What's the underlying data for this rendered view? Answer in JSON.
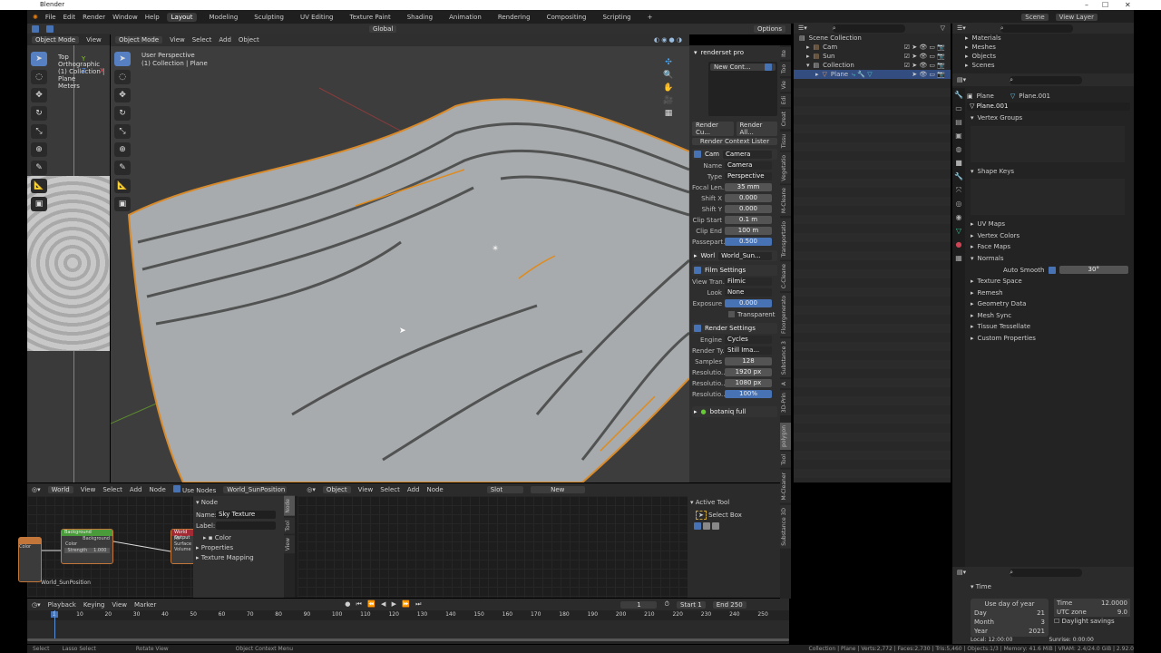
{
  "window": {
    "title": "Blender",
    "controls": [
      "–",
      "☐",
      "✕"
    ]
  },
  "menu": {
    "items": [
      "File",
      "Edit",
      "Render",
      "Window",
      "Help"
    ],
    "workspaces": [
      "Layout",
      "Modeling",
      "Sculpting",
      "UV Editing",
      "Texture Paint",
      "Shading",
      "Animation",
      "Rendering",
      "Compositing",
      "Scripting",
      "+"
    ],
    "active_workspace": "Layout",
    "scene": "Scene",
    "view_layer": "View Layer"
  },
  "viewport_header": {
    "mode": "Object Mode",
    "items": [
      "View",
      "Select",
      "Add",
      "Object"
    ],
    "orientation": "Global",
    "options": "Options"
  },
  "left_viewport": {
    "mode": "Object Mode",
    "view": "View",
    "overlay_title": "Top Orthographic",
    "overlay_collection": "(1) Collection | Plane",
    "overlay_units": "Meters",
    "gizmo": {
      "y": "Y",
      "z": "Z",
      "x": "X"
    }
  },
  "main_viewport": {
    "overlay_title": "User Perspective",
    "overlay_collection": "(1) Collection | Plane"
  },
  "npanel": {
    "renderset": {
      "title": "renderset pro",
      "context": "New Cont...",
      "render_current": "Render Cu...",
      "render_all": "Render All...",
      "lister": "Render Context Lister"
    },
    "camera": {
      "label": "Cam",
      "value": "Camera",
      "fields": [
        {
          "label": "Name",
          "value": "Camera"
        },
        {
          "label": "Type",
          "value": "Perspective"
        },
        {
          "label": "Focal Len...",
          "value": "35 mm"
        },
        {
          "label": "Shift X",
          "value": "0.000"
        },
        {
          "label": "Shift Y",
          "value": "0.000"
        },
        {
          "label": "Clip Start",
          "value": "0.1 m"
        },
        {
          "label": "Clip End",
          "value": "100 m"
        },
        {
          "label": "Passepart...",
          "value": "0.500",
          "fraction": 0.5
        }
      ]
    },
    "world": {
      "label": "Worl",
      "value": "World_Sun..."
    },
    "film": {
      "title": "Film Settings",
      "view_transform_label": "View Tran...",
      "view_transform": "Filmic",
      "look_label": "Look",
      "look": "None",
      "exposure_label": "Exposure",
      "exposure": "0.000",
      "transparent": "Transparent"
    },
    "render": {
      "title": "Render Settings",
      "engine_label": "Engine",
      "engine": "Cycles",
      "render_type_label": "Render Ty...",
      "render_type": "Still Ima...",
      "samples_label": "Samples",
      "samples": "128",
      "res_label": "Resolutio...",
      "res_x": "1920 px",
      "res_y": "1080 px",
      "res_pct": "100%"
    },
    "botaniq": "botaniq full"
  },
  "vtabs": [
    "Ite",
    "Too",
    "Vie",
    "Edi",
    "Creat",
    "Tissu",
    "Vegetatio",
    "M-Cleane",
    "Transportatio",
    "C-Cleane",
    "Floorgenerato",
    "Substance 3",
    "A",
    "3D-Prin",
    "polygon",
    "Tool",
    "M-Cleaner",
    "Substance 3D"
  ],
  "outliner": {
    "rows": [
      {
        "name": "Scene Collection"
      },
      {
        "name": "Cam"
      },
      {
        "name": "Sun"
      },
      {
        "name": "Collection"
      },
      {
        "name": "Plane",
        "selected": true
      }
    ]
  },
  "blend_outliner": {
    "rows": [
      "Materials",
      "Meshes",
      "Objects",
      "Scenes"
    ]
  },
  "properties": {
    "object": "Plane",
    "mesh": "Plane.001",
    "mesh_field": "Plane.001",
    "vertex_groups": "Vertex Groups",
    "shape_keys": "Shape Keys",
    "sections": [
      "UV Maps",
      "Vertex Colors",
      "Face Maps",
      "Normals"
    ],
    "auto_smooth_label": "Auto Smooth",
    "auto_smooth_angle": "30°",
    "sections2": [
      "Texture Space",
      "Remesh",
      "Geometry Data",
      "Mesh Sync",
      "Tissue Tessellate",
      "Custom Properties"
    ]
  },
  "sun_panel": {
    "title": "Time",
    "use_day": "Use day of year",
    "day_label": "Day",
    "day": "21",
    "month_label": "Month",
    "month": "3",
    "year_label": "Year",
    "year": "2021",
    "time_label": "Time",
    "time": "12.0000",
    "utc_label": "UTC zone",
    "utc": "9.0",
    "daylight": "Daylight savings",
    "local": "Local: 12:00:00",
    "sunrise": "Sunrise: 0:00:00"
  },
  "node_editor": {
    "type": "World",
    "items": [
      "View",
      "Select",
      "Add",
      "Node"
    ],
    "use_nodes": "Use Nodes",
    "world_name": "World_SunPosition",
    "panel": {
      "title": "Node",
      "name_label": "Name:",
      "name": "Sky Texture",
      "label_label": "Label:",
      "color": "Color",
      "properties": "Properties",
      "texture_mapping": "Texture Mapping"
    },
    "tabs": [
      "Node",
      "Tool",
      "View"
    ],
    "background_node": {
      "title": "Background",
      "out": "Background",
      "in": "Color",
      "strength_label": "Strength",
      "strength": "1.000"
    },
    "output_node": {
      "title": "World Output",
      "target": "All",
      "surface": "Surface",
      "volume": "Volume"
    },
    "frame_label": "World_SunPosition",
    "color_socket": "Color"
  },
  "shader_editor": {
    "type": "Object",
    "items": [
      "View",
      "Select",
      "Add",
      "Node"
    ],
    "slot": "Slot",
    "new": "New",
    "active_tool": "Active Tool",
    "select_box": "Select Box"
  },
  "timeline": {
    "items": [
      "Playback",
      "Keying",
      "View",
      "Marker"
    ],
    "current": "1",
    "start_label": "Start",
    "start": "1",
    "end_label": "End",
    "end": "250",
    "ticks": [
      "1",
      "10",
      "20",
      "30",
      "40",
      "50",
      "60",
      "70",
      "80",
      "90",
      "100",
      "110",
      "120",
      "130",
      "140",
      "150",
      "160",
      "170",
      "180",
      "190",
      "200",
      "210",
      "220",
      "230",
      "240",
      "250"
    ]
  },
  "statusbar": {
    "select": "Select",
    "lasso": "Lasso Select",
    "rotate": "Rotate View",
    "context": "Object Context Menu",
    "stats": "Collection | Plane | Verts:2,772 | Faces:2,730 | Tris:5,460 | Objects:1/3 | Memory: 41.6 MiB | VRAM: 2.4/24.0 GiB | 2.92.0"
  }
}
